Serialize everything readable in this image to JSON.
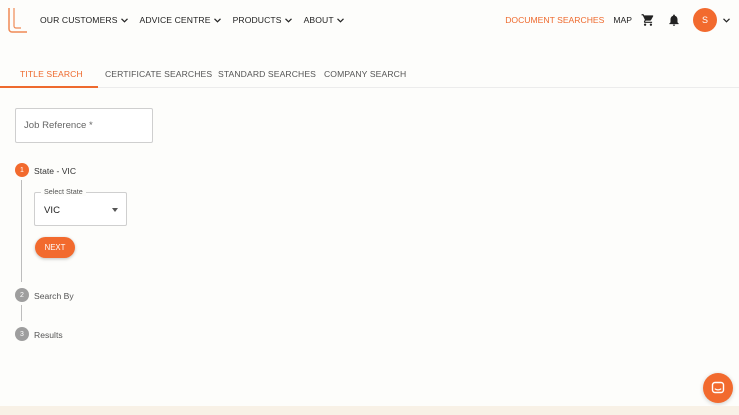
{
  "header": {
    "nav": [
      {
        "label": "OUR CUSTOMERS"
      },
      {
        "label": "ADVICE CENTRE"
      },
      {
        "label": "PRODUCTS"
      },
      {
        "label": "ABOUT"
      }
    ],
    "document_searches": "DOCUMENT SEARCHES",
    "map": "MAP",
    "avatar_initial": "S",
    "icons": [
      "logo-icon",
      "cart-icon",
      "bell-icon",
      "chevron-down-icon"
    ]
  },
  "tabs": [
    {
      "label": "TITLE SEARCH",
      "active": true
    },
    {
      "label": "CERTIFICATE SEARCHES",
      "active": false
    },
    {
      "label": "STANDARD SEARCHES",
      "active": false
    },
    {
      "label": "COMPANY SEARCH",
      "active": false
    }
  ],
  "form": {
    "job_reference_placeholder": "Job Reference *",
    "steps": [
      {
        "number": "1",
        "label": "State - VIC",
        "active": true
      },
      {
        "number": "2",
        "label": "Search By",
        "active": false
      },
      {
        "number": "3",
        "label": "Results",
        "active": false
      }
    ],
    "select_state_label": "Select State",
    "select_state_value": "VIC",
    "next_label": "NEXT"
  },
  "colors": {
    "accent": "#f26a2e",
    "inactive_step": "#9e9e9e",
    "background": "#fdfdfb"
  },
  "chat_icon": "chat-icon"
}
